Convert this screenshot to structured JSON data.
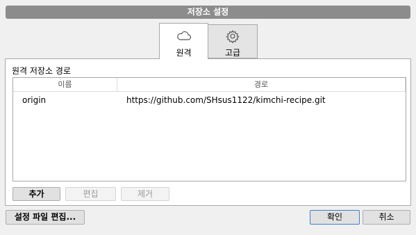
{
  "window": {
    "title": "저장소 설정"
  },
  "tabs": [
    {
      "label": "원격",
      "icon": "cloud-icon",
      "active": true
    },
    {
      "label": "고급",
      "icon": "gear-icon",
      "active": false
    }
  ],
  "remote": {
    "section_label": "원격 저장소 경로",
    "table": {
      "columns": [
        "이름",
        "경로"
      ],
      "rows": [
        {
          "name": "origin",
          "path": "https://github.com/SHsus1122/kimchi-recipe.git"
        }
      ]
    },
    "buttons": {
      "add": "추가",
      "edit": "편집",
      "remove": "제거"
    }
  },
  "footer": {
    "edit_config": "설정 파일 편집...",
    "ok": "확인",
    "cancel": "취소"
  }
}
